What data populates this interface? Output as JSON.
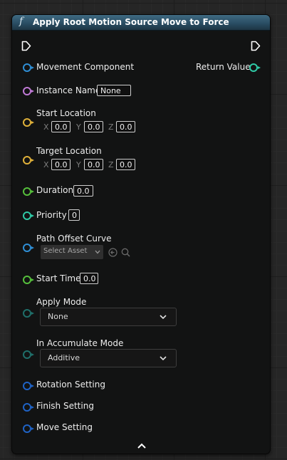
{
  "node": {
    "title": "Apply Root Motion Source Move to Force",
    "fn_icon": "f",
    "return_label": "Return Value"
  },
  "colors": {
    "object_pin": "#2f8fd6",
    "string_pin": "#c07ad6",
    "vector_pin": "#e0b13a",
    "float_pin": "#56c03c",
    "int_pin": "#2fcaa6",
    "enum_pin": "#1f6f6a",
    "struct_pin": "#1f63c6",
    "return_pin": "#2fcaa6"
  },
  "pins": {
    "movement_component": "Movement Component",
    "instance_name": {
      "label": "Instance Name",
      "value": "None"
    },
    "start_location": {
      "label": "Start Location",
      "x": "0.0",
      "y": "0.0",
      "z": "0.0"
    },
    "target_location": {
      "label": "Target Location",
      "x": "0.0",
      "y": "0.0",
      "z": "0.0"
    },
    "duration": {
      "label": "Duration",
      "value": "0.0"
    },
    "priority": {
      "label": "Priority",
      "value": "0"
    },
    "path_offset_curve": {
      "label": "Path Offset Curve",
      "placeholder": "Select Asset"
    },
    "start_time": {
      "label": "Start Time",
      "value": "0.0"
    },
    "apply_mode": {
      "label": "Apply Mode",
      "value": "None"
    },
    "accumulate_mode": {
      "label": "In Accumulate Mode",
      "value": "Additive"
    },
    "rotation_setting": "Rotation Setting",
    "finish_setting": "Finish Setting",
    "move_setting": "Move Setting"
  },
  "axes": {
    "x": "X",
    "y": "Y",
    "z": "Z"
  },
  "icons": {
    "function": "function-icon",
    "exec_in": "exec-in-icon",
    "exec_out": "exec-out-icon",
    "chevron": "chevron-down-icon",
    "use_asset": "arrow-left-circle-icon",
    "browse": "search-icon",
    "collapse": "chevron-up-icon"
  }
}
